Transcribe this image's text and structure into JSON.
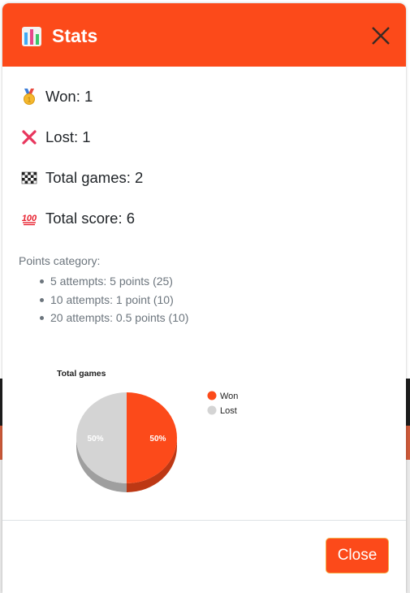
{
  "modal": {
    "title": "Stats",
    "title_icon": "bar-chart-icon",
    "close_icon": "close-icon",
    "header_color": "#fc4a1a"
  },
  "stats": [
    {
      "icon": "medal-icon",
      "text": "Won: 1"
    },
    {
      "icon": "cross-mark-icon",
      "text": "Lost: 1"
    },
    {
      "icon": "checkered-flag-icon",
      "text": "Total games: 2"
    },
    {
      "icon": "hundred-points-icon",
      "text": "Total score: 6"
    }
  ],
  "points_category": {
    "title": "Points category:",
    "items": [
      "5 attempts: 5 points (25)",
      "10 attempts: 1 point (10)",
      "20 attempts: 0.5 points (10)"
    ]
  },
  "chart_data": {
    "type": "pie",
    "title": "Total games",
    "labels": [
      "Won",
      "Lost"
    ],
    "values": [
      1,
      1
    ],
    "percent_labels": [
      "50%",
      "50%"
    ],
    "colors": [
      "#fc4a1a",
      "#d4d4d4"
    ],
    "legend_position": "right",
    "is_3d": true
  },
  "footer": {
    "close_label": "Close"
  }
}
